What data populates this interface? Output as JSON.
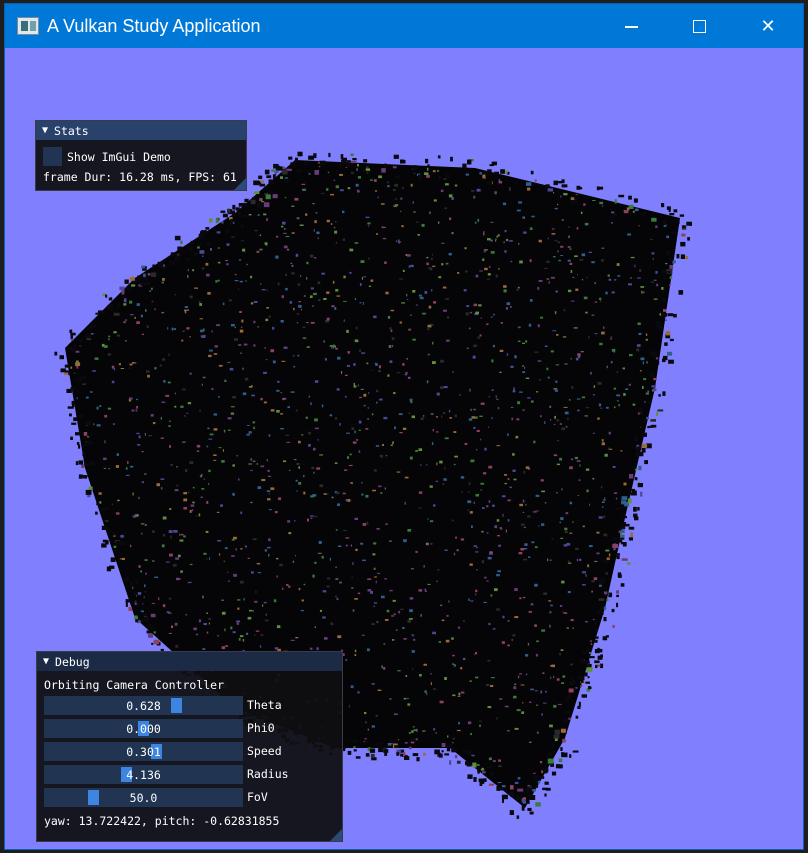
{
  "window": {
    "title": "A Vulkan Study Application",
    "background_color": "#8080ff",
    "titlebar_color": "#0078d7",
    "app_icon": "vulkan-app-icon",
    "controls": {
      "minimize": "minimize-icon",
      "maximize": "maximize-icon",
      "close": "close-icon"
    }
  },
  "stats": {
    "header": "Stats",
    "checkbox_label": "Show ImGui Demo",
    "checkbox_checked": false,
    "frame_info": "frame Dur: 16.28 ms, FPS: 61"
  },
  "debug": {
    "header": "Debug",
    "section_title": "Orbiting Camera Controller",
    "sliders": [
      {
        "label": "Theta",
        "value_text": "0.628",
        "fill": 0.68
      },
      {
        "label": "Phi0",
        "value_text": "0.000",
        "fill": 0.5
      },
      {
        "label": "Speed",
        "value_text": "0.301",
        "fill": 0.57
      },
      {
        "label": "Radius",
        "value_text": "4.136",
        "fill": 0.41
      },
      {
        "label": "FoV",
        "value_text": "50.0",
        "fill": 0.23
      }
    ],
    "camera_info": "yaw: 13.722422, pitch: -0.62831855"
  },
  "colors": {
    "panel_bg": "#0f0f12",
    "header_active": "#29426b",
    "slider_bg": "#213452",
    "slider_grab": "#3d85e0"
  }
}
